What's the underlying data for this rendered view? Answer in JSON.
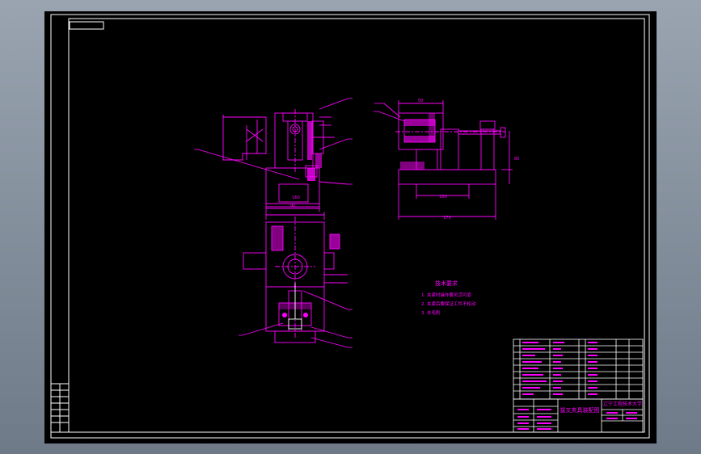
{
  "drawing": {
    "title_block_name": "拔叉夹具装配图",
    "school": "辽宁工程技术大学",
    "tech_req_title": "技术要求",
    "tech_req_lines": [
      "1. 夹紧时操作要灵活可靠",
      "2. 夹紧后要保证工件不松动",
      "3. 去毛刺"
    ],
    "dim_labels": {
      "front_width": "160",
      "front_base": "90",
      "side_width": "170",
      "side_top": "50",
      "side_base": "100",
      "side_height": "80",
      "plan_mark": "6"
    }
  },
  "colors": {
    "sheet_bg": "#000000",
    "frame": "#ffffff",
    "geometry": "#ff00ff",
    "hatch": "#ff00ff"
  }
}
